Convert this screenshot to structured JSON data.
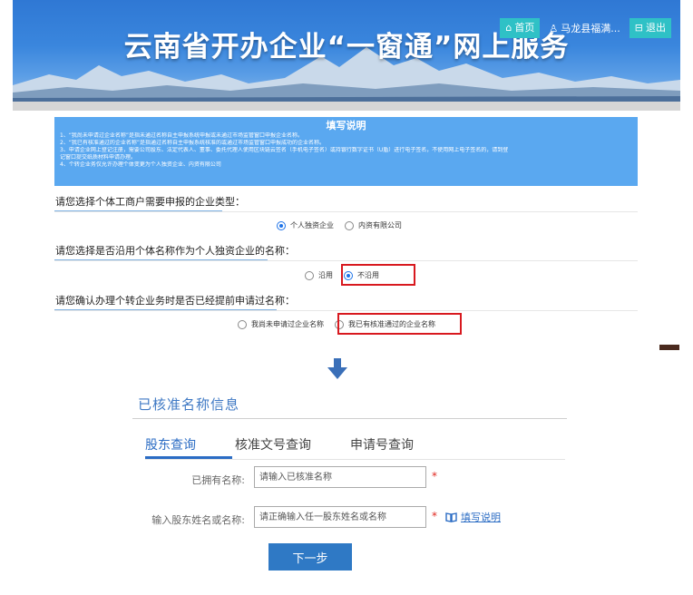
{
  "header": {
    "title": "云南省开办企业“一窗通”网上服务",
    "home_label": "首页",
    "user_label": "马龙县福满...",
    "logout_label": "退出"
  },
  "notice": {
    "title": "填写说明",
    "lines": [
      "1、“我尚未申请过企业名称”是指未通过名称自主申报系统申报或未通过市场监管窗口申报企业名称。",
      "2、“我已有核准通过的企业名称”是指通过名称自主申报系统核准的或通过市场监管窗口申报成功的企业名称。",
      "3、申请企业网上登记注册，需要公司股东、法定代表人、董事、委托代理人使用区块链云签名（手机电子签名）或持银行数字证书（U盾）进行电子签名，不使用网上电子签名的，请到登",
      "记窗口提交纸质材料申请办理。",
      "4、个转企业务仅允许办理个体变更为个人独资企业、内资有限公司"
    ]
  },
  "q1": {
    "label": "请您选择个体工商户需要申报的企业类型：",
    "options": [
      "个人独资企业",
      "内资有限公司"
    ],
    "selected": "个人独资企业"
  },
  "q2": {
    "label": "请您选择是否沿用个体名称作为个人独资企业的名称：",
    "options": [
      "沿用",
      "不沿用"
    ],
    "selected": "不沿用"
  },
  "q3": {
    "label": "请您确认办理个转企业务时是否已经提前申请过名称：",
    "options": [
      "我尚未申请过企业名称",
      "我已有核准通过的企业名称"
    ],
    "selected": ""
  },
  "approved": {
    "title": "已核准名称信息",
    "tabs": [
      "股东查询",
      "核准文号查询",
      "申请号查询"
    ],
    "active_tab": "股东查询",
    "field1": {
      "label": "已拥有名称:",
      "placeholder": "请输入已核准名称"
    },
    "field2": {
      "label": "输入股东姓名或名称:",
      "placeholder": "请正确输入任一股东姓名或名称"
    },
    "required_mark": "*",
    "help_label": "填写说明",
    "next_label": "下一步"
  },
  "colors": {
    "banner_blue": "#3a86dd",
    "accent": "#2f79c5",
    "notice_bg": "#5aa8f0",
    "highlight_red": "#d8191f",
    "teal_button": "#2fc1c6"
  }
}
